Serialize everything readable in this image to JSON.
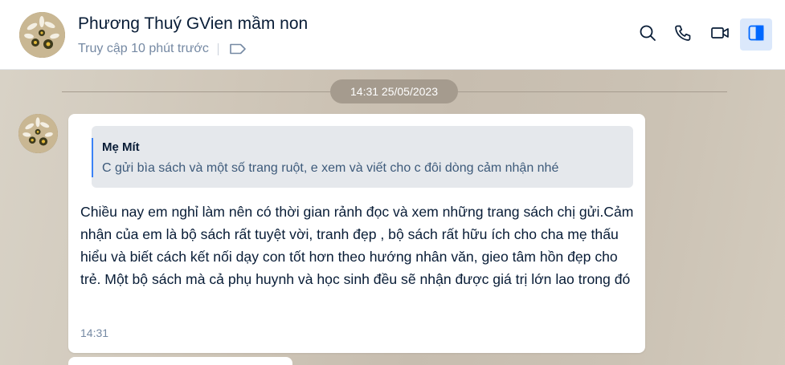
{
  "header": {
    "contact_name": "Phương Thuý GVien mầm non",
    "status": "Truy cập 10 phút trước",
    "icons": {
      "label": "tag-icon",
      "search": "search-icon",
      "call": "phone-icon",
      "video": "video-call-icon",
      "panel": "sidebar-toggle-icon"
    },
    "accent_color": "#0068ff"
  },
  "chat": {
    "date_divider": "14:31 25/05/2023",
    "message": {
      "quote": {
        "author": "Mẹ Mít",
        "text": "C gửi bìa sách và một số trang ruột, e xem và viết cho c đôi dòng cảm nhận nhé"
      },
      "text": "Chiều nay em nghỉ làm nên có thời gian rảnh đọc và xem những trang  sách chị gửi.Cảm nhận của em là bộ sách rất tuyệt vời, tranh đẹp , bộ sách rất hữu ích cho cha mẹ thấu hiểu và biết cách kết nối dạy con tốt hơn theo hướng nhân văn, gieo tâm hồn đẹp cho trẻ. Một bộ sách mà cả phụ huynh và học sinh đều sẽ nhận được giá trị lớn lao trong đó",
      "time": "14:31"
    }
  }
}
